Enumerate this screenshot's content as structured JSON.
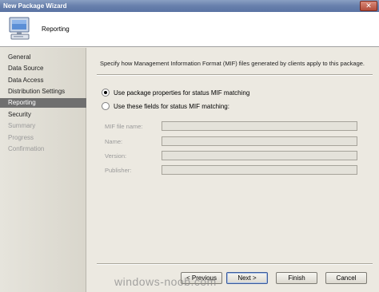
{
  "window": {
    "title": "New Package Wizard",
    "close_glyph": "✕"
  },
  "header": {
    "title": "Reporting",
    "icon": "computer-icon"
  },
  "nav": {
    "items": [
      {
        "label": "General",
        "state": "normal"
      },
      {
        "label": "Data Source",
        "state": "normal"
      },
      {
        "label": "Data Access",
        "state": "normal"
      },
      {
        "label": "Distribution Settings",
        "state": "normal"
      },
      {
        "label": "Reporting",
        "state": "active"
      },
      {
        "label": "Security",
        "state": "normal"
      },
      {
        "label": "Summary",
        "state": "disabled"
      },
      {
        "label": "Progress",
        "state": "disabled"
      },
      {
        "label": "Confirmation",
        "state": "disabled"
      }
    ]
  },
  "content": {
    "description": "Specify how Management Information Format (MIF) files generated by clients apply to this package.",
    "radio_package": {
      "label": "Use package properties for status MIF matching",
      "selected": true
    },
    "radio_fields": {
      "label": "Use these fields for status MIF matching:",
      "selected": false
    },
    "fields": {
      "mif_file_name": {
        "label": "MIF file name:",
        "value": ""
      },
      "name": {
        "label": "Name:",
        "value": ""
      },
      "version": {
        "label": "Version:",
        "value": ""
      },
      "publisher": {
        "label": "Publisher:",
        "value": ""
      }
    }
  },
  "buttons": {
    "previous": "< Previous",
    "next": "Next >",
    "finish": "Finish",
    "cancel": "Cancel"
  },
  "watermark": "windows-noob.com"
}
